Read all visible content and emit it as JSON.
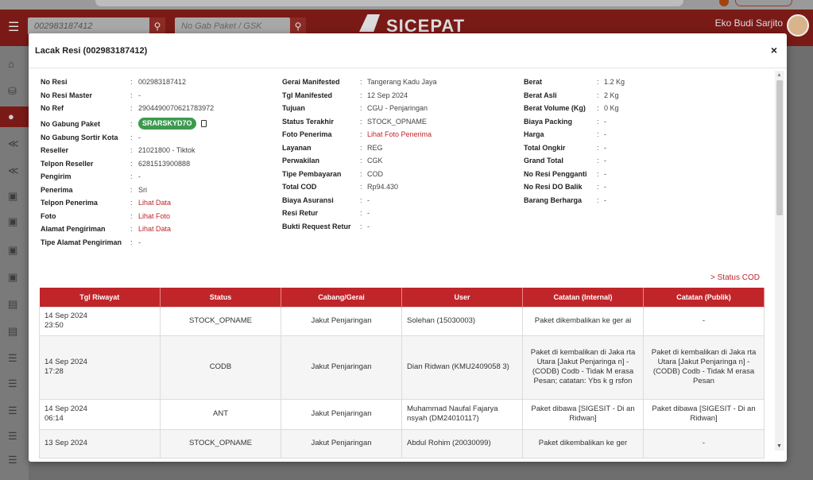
{
  "header": {
    "search_resi_value": "002983187412",
    "search_paket_placeholder": "No Gab Paket / GSK",
    "brand": "SICEPAT",
    "user_name": "Eko Budi Sarjito"
  },
  "modal": {
    "title": "Lacak Resi (002983187412)",
    "close": "×"
  },
  "info_col1": [
    {
      "label": "No Resi",
      "value": "002983187412"
    },
    {
      "label": "No Resi Master",
      "value": "-"
    },
    {
      "label": "No Ref",
      "value": "2904490070621783972"
    },
    {
      "label": "No Gabung Paket",
      "value": "SRARSKYD7O"
    },
    {
      "label": "No Gabung Sortir Kota",
      "value": "-"
    },
    {
      "label": "Reseller",
      "value": "21021800 - Tiktok"
    },
    {
      "label": "Telpon Reseller",
      "value": "6281513900888"
    },
    {
      "label": "Pengirim",
      "value": "-"
    },
    {
      "label": "Penerima",
      "value": "Sri"
    },
    {
      "label": "Telpon Penerima",
      "value": "Lihat Data"
    },
    {
      "label": "Foto",
      "value": "Lihat Foto"
    },
    {
      "label": "Alamat Pengiriman",
      "value": "Lihat Data"
    },
    {
      "label": "Tipe Alamat Pengiriman",
      "value": "-"
    }
  ],
  "info_col2": [
    {
      "label": "Gerai Manifested",
      "value": "Tangerang Kadu Jaya"
    },
    {
      "label": "Tgl Manifested",
      "value": "12 Sep 2024"
    },
    {
      "label": "Tujuan",
      "value": "CGU - Penjaringan"
    },
    {
      "label": "Status Terakhir",
      "value": "STOCK_OPNAME"
    },
    {
      "label": "Foto Penerima",
      "value": "Lihat Foto Penerima"
    },
    {
      "label": "Layanan",
      "value": "REG"
    },
    {
      "label": "Perwakilan",
      "value": "CGK"
    },
    {
      "label": "Tipe Pembayaran",
      "value": "COD"
    },
    {
      "label": "Total COD",
      "value": "Rp94.430"
    },
    {
      "label": "Biaya Asuransi",
      "value": "-"
    },
    {
      "label": "Resi Retur",
      "value": "-"
    },
    {
      "label": "Bukti Request Retur",
      "value": "-"
    }
  ],
  "info_col3": [
    {
      "label": "Berat",
      "value": "1.2 Kg"
    },
    {
      "label": "Berat Asli",
      "value": "2 Kg"
    },
    {
      "label": "Berat Volume (Kg)",
      "value": "0 Kg"
    },
    {
      "label": "Biaya Packing",
      "value": "-"
    },
    {
      "label": "Harga",
      "value": "-"
    },
    {
      "label": "Total Ongkir",
      "value": "-"
    },
    {
      "label": "Grand Total",
      "value": "-"
    },
    {
      "label": "No Resi Pengganti",
      "value": "-"
    },
    {
      "label": "No Resi DO Balik",
      "value": "-"
    },
    {
      "label": "Barang Berharga",
      "value": "-"
    }
  ],
  "status_cod_link": "> Status COD",
  "history": {
    "columns": [
      "Tgl Riwayat",
      "Status",
      "Cabang/Gerai",
      "User",
      "Catatan (Internal)",
      "Catatan (Publik)"
    ],
    "rows": [
      {
        "date": "14 Sep 2024",
        "time": "23:50",
        "status": "STOCK_OPNAME",
        "cabang": "Jakut Penjaringan",
        "user": "Solehan (15030003)",
        "internal": "Paket dikembalikan ke ger ai",
        "publik": "-"
      },
      {
        "date": "14 Sep 2024",
        "time": "17:28",
        "status": "CODB",
        "cabang": "Jakut Penjaringan",
        "user": "Dian Ridwan (KMU2409058 3)",
        "internal": "Paket di kembalikan di Jaka rta Utara [Jakut Penjaringa n] - (CODB) Codb - Tidak M erasa Pesan; catatan: Ybs k g rsfon",
        "publik": "Paket di kembalikan di Jaka rta Utara [Jakut Penjaringa n] - (CODB) Codb - Tidak M erasa Pesan"
      },
      {
        "date": "14 Sep 2024",
        "time": "06:14",
        "status": "ANT",
        "cabang": "Jakut Penjaringan",
        "user": "Muhammad Naufal Fajarya nsyah (DM24010117)",
        "internal": "Paket dibawa [SIGESIT - Di an Ridwan]",
        "publik": "Paket dibawa [SIGESIT - Di an Ridwan]"
      },
      {
        "date": "13 Sep 2024",
        "time": "",
        "status": "STOCK_OPNAME",
        "cabang": "Jakut Penjaringan",
        "user": "Abdul Rohim (20030099)",
        "internal": "Paket dikembalikan ke ger",
        "publik": "-"
      }
    ]
  },
  "colors": {
    "primary_red": "#c0252a",
    "badge_green": "#3c9a4f",
    "topbar_dark": "#7a1a16"
  },
  "icons": {
    "menu": "hamburger-icon",
    "search": "search-icon",
    "close": "close-icon",
    "copy": "copy-icon"
  }
}
